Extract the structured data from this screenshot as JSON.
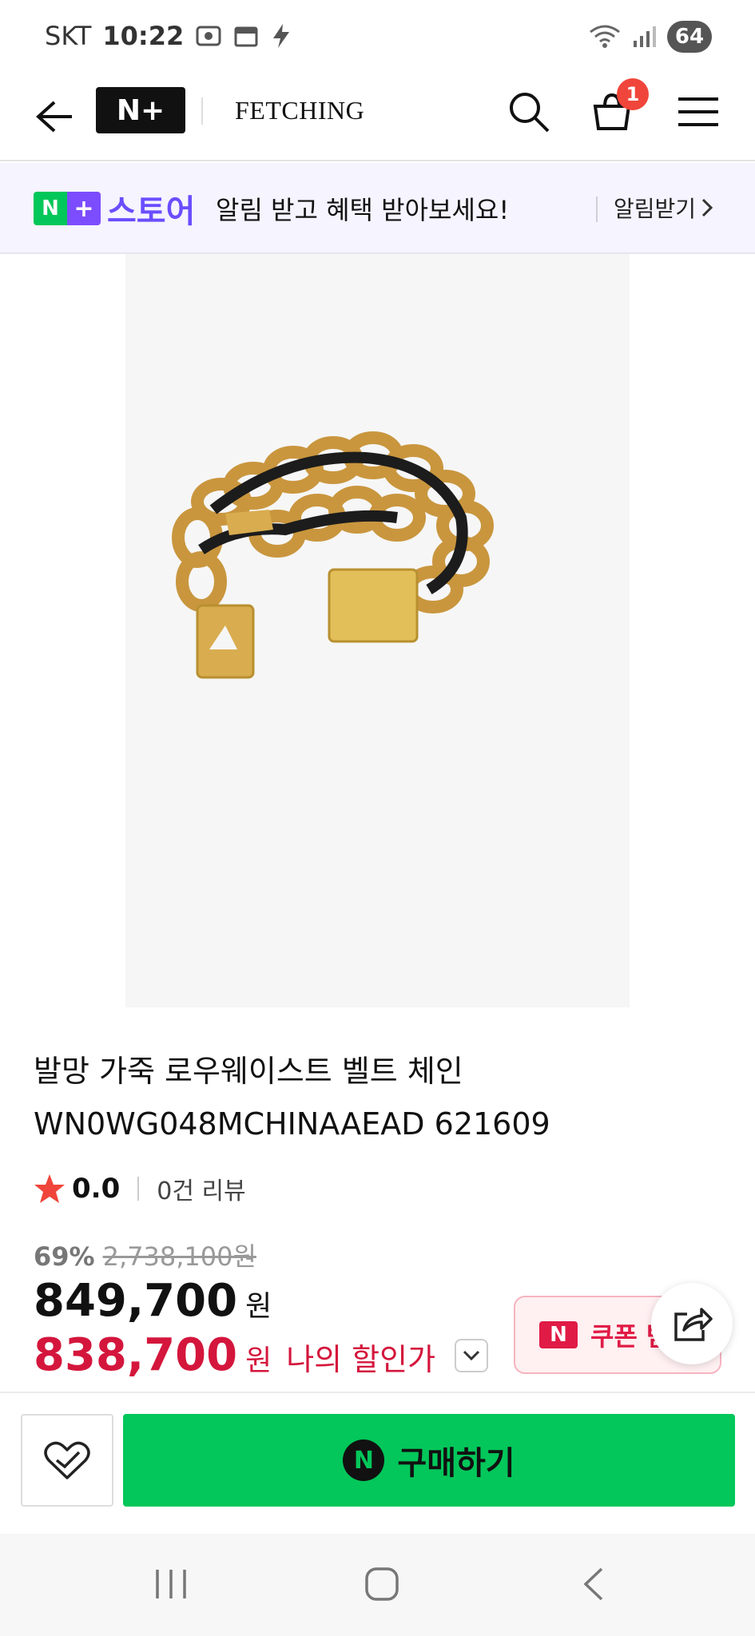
{
  "status_bar": {
    "carrier": "SKT",
    "time": "10:22",
    "battery": "64"
  },
  "header": {
    "logo": "N+",
    "brand": "FETCHING",
    "cart_count": "1"
  },
  "promo": {
    "logo_n": "N",
    "logo_plus": "+",
    "store": "스토어",
    "message": "알림 받고 혜택 받아보세요!",
    "action": "알림받기"
  },
  "product": {
    "title_line1": "발망 가죽 로우웨이스트 벨트 체인",
    "title_line2": "WN0WG048MCHINAAEAD 621609",
    "rating": "0.0",
    "reviews": "0건 리뷰",
    "discount_rate": "69%",
    "original_price": "2,738,100원",
    "price": "849,700",
    "price_unit": "원",
    "my_price": "838,700",
    "my_price_unit": "원",
    "my_price_label": "나의 할인가"
  },
  "coupon": {
    "icon": "N",
    "label": "쿠폰 받기"
  },
  "bottom_bar": {
    "buy_icon": "N",
    "buy_label": "구매하기"
  },
  "colors": {
    "naver_green": "#03c75a",
    "accent_red": "#d4163c",
    "promo_purple": "#6b4dff"
  },
  "icons": [
    "back-arrow-icon",
    "search-icon",
    "cart-icon",
    "menu-icon",
    "chevron-right-icon",
    "star-icon",
    "chevron-down-icon",
    "share-icon",
    "heart-check-icon",
    "nav-recent-icon",
    "nav-home-icon",
    "nav-back-icon"
  ]
}
